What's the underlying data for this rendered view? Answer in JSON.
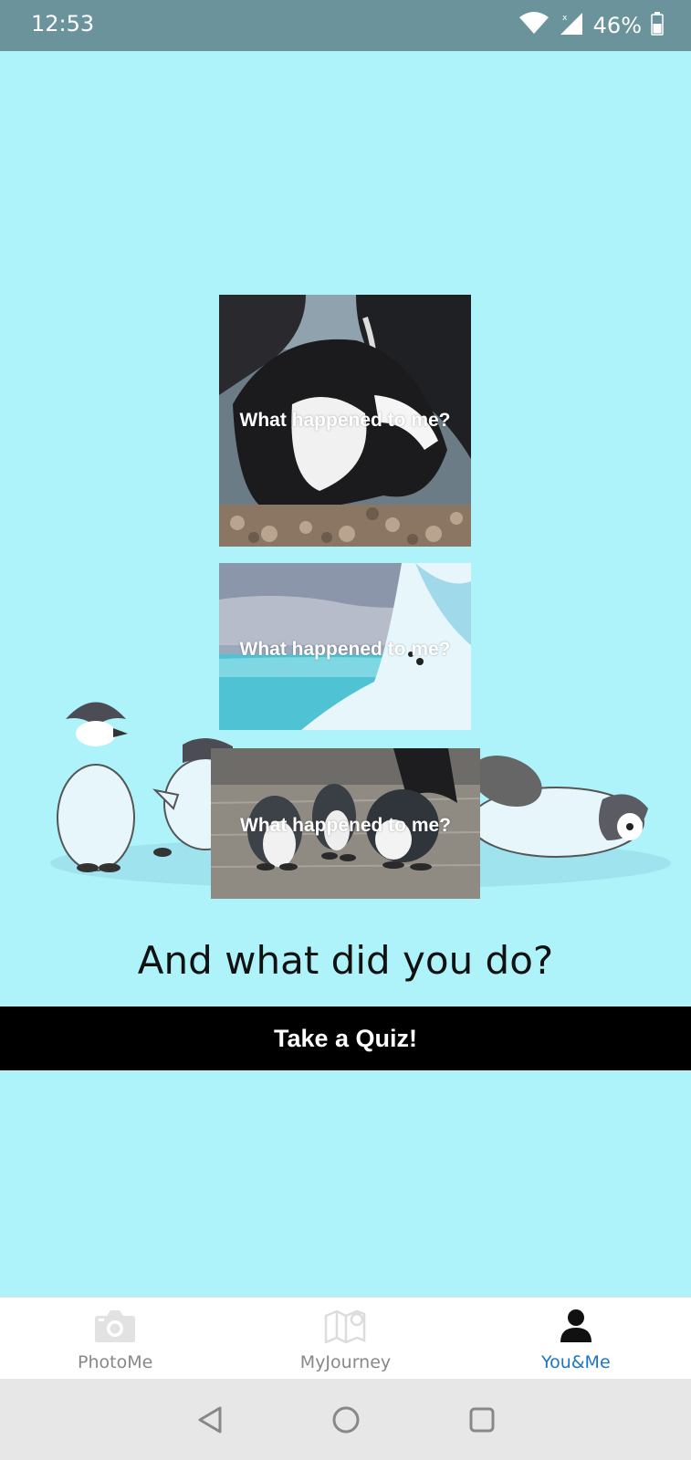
{
  "status_bar": {
    "time": "12:53",
    "battery_percent": "46%"
  },
  "cards": [
    {
      "caption": "What happened to me?"
    },
    {
      "caption": "What happened to me?"
    },
    {
      "caption": "What happened to me?"
    }
  ],
  "main": {
    "question": "And what did you do?",
    "quiz_button_label": "Take a Quiz!"
  },
  "bottom_nav": {
    "items": [
      {
        "label": "PhotoMe",
        "icon": "camera-icon",
        "active": false
      },
      {
        "label": "MyJourney",
        "icon": "map-icon",
        "active": false
      },
      {
        "label": "You&Me",
        "icon": "person-icon",
        "active": true
      }
    ]
  },
  "colors": {
    "background": "#aef3fa",
    "status_bar": "#6a939b",
    "active_tab": "#1b74c9",
    "button": "#000000"
  }
}
